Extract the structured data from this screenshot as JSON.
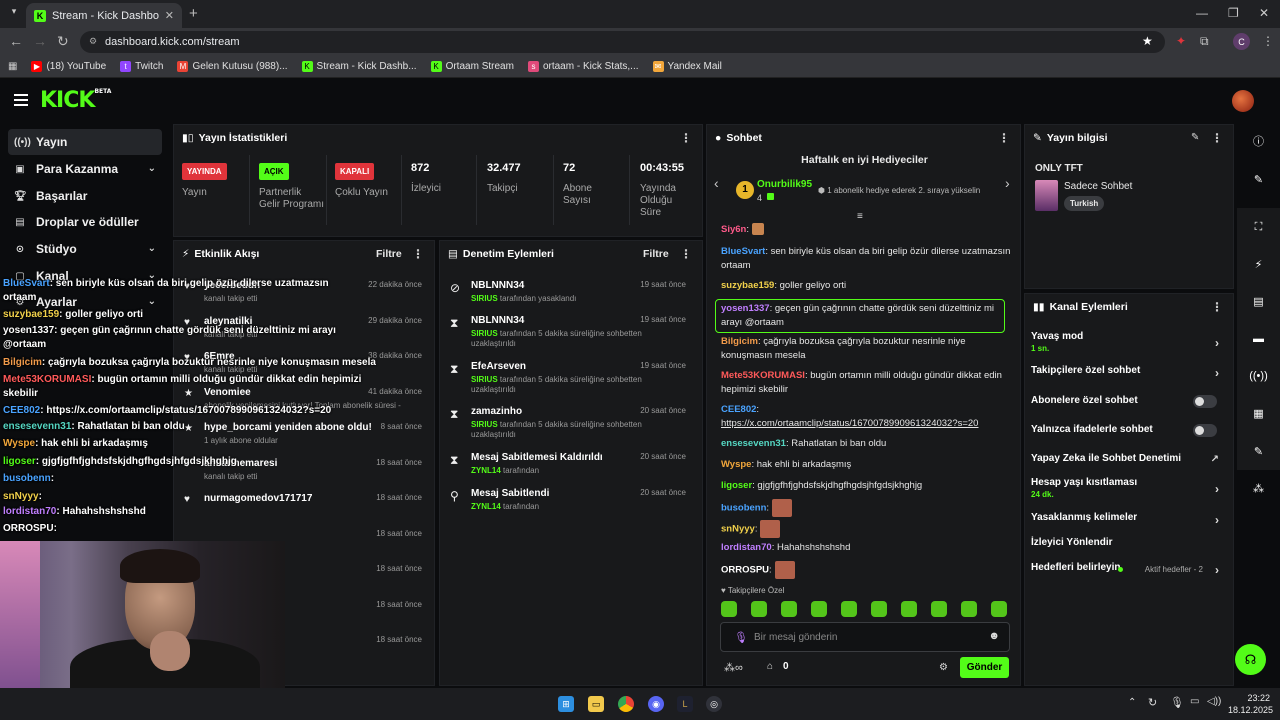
{
  "browser": {
    "tab_title": "Stream - Kick Dashboard",
    "url": "dashboard.kick.com/stream",
    "profile_initial": "C",
    "bookmarks": [
      {
        "label": "(18) YouTube",
        "color": "#ff0000",
        "icon": "youtube-icon"
      },
      {
        "label": "Twitch",
        "color": "#9146ff",
        "icon": "twitch-icon"
      },
      {
        "label": "Gelen Kutusu (988)...",
        "color": "#ea4335",
        "icon": "gmail-icon"
      },
      {
        "label": "Stream - Kick Dashb...",
        "color": "#53fc18",
        "icon": "kick-icon"
      },
      {
        "label": "Ortaam Stream",
        "color": "#53fc18",
        "icon": "kick-icon"
      },
      {
        "label": "ortaam - Kick Stats,...",
        "color": "#e04a7a",
        "icon": "stats-icon"
      },
      {
        "label": "Yandex Mail",
        "color": "#f2a73b",
        "icon": "mail-icon"
      }
    ]
  },
  "kick": {
    "logo": "KICK",
    "logo_sup": "BETA"
  },
  "sidebar": {
    "items": [
      {
        "label": "Yayın",
        "icon": "broadcast-icon"
      },
      {
        "label": "Para Kazanma",
        "icon": "money-icon"
      },
      {
        "label": "Başarılar",
        "icon": "trophy-icon"
      },
      {
        "label": "Droplar ve ödüller",
        "icon": "gift-icon"
      },
      {
        "label": "Stüdyo",
        "icon": "studio-icon"
      },
      {
        "label": "Kanal",
        "icon": "channel-icon"
      },
      {
        "label": "Ayarlar",
        "icon": "settings-icon"
      }
    ]
  },
  "overlay_chat": [
    {
      "user": "BlueSvart",
      "color": "#4aa3ff",
      "text": ": sen biriyle küs olsan da biri gelip özür dilerse uzatmazsın"
    },
    {
      "user": "",
      "color": "#fff",
      "text": "ortaam"
    },
    {
      "user": "suzybae159",
      "color": "#f2d14b",
      "text": ": goller geliyo orti"
    },
    {
      "user": "yosen1337",
      "color": "#ffffff",
      "text": ": geçen gün çağrının chatte gördük seni düzelttiniz mi arayı"
    },
    {
      "user": "",
      "color": "#fff",
      "text": "@ortaam"
    },
    {
      "user": "Bilgicim",
      "color": "#f29b4b",
      "text": ": çağrıyla bozuksa çağrıyla bozuktur nesrinle niye konuşmasın mesela"
    },
    {
      "user": "Mete53KORUMASI",
      "color": "#ff5a5a",
      "text": ": bugün ortamın milli olduğu gündür dikkat edin hepimizi"
    },
    {
      "user": "",
      "color": "#fff",
      "text": "skebilir"
    },
    {
      "user": "CEE802",
      "color": "#4aa3ff",
      "text": ": https://x.com/ortaamclip/status/1670078990961324032?s=20"
    },
    {
      "user": "ensesevenn31",
      "color": "#55d6c2",
      "text": ": Rahatlatan bi ban oldu"
    },
    {
      "user": "Wyspe",
      "color": "#f2a73b",
      "text": ": hak ehli bi arkadaşmış"
    },
    {
      "user": "ligoser",
      "color": "#53fc18",
      "text": ": gjgfjgfhfjghdsfskjdhgfhgdsjhfgdsjkhghjg"
    },
    {
      "user": "busobenn",
      "color": "#4aa3ff",
      "text": ":"
    },
    {
      "user": "snNyyy",
      "color": "#f2d14b",
      "text": ":"
    },
    {
      "user": "lordistan70",
      "color": "#c07fff",
      "text": ": Hahahshshshshd"
    },
    {
      "user": "ORROSPU",
      "color": "#ffffff",
      "text": ":"
    }
  ],
  "stats": {
    "title": "Yayın İstatistikleri",
    "items": [
      {
        "badge": "YAYINDA",
        "badge_color": "#e0343b",
        "label": "Yayın"
      },
      {
        "badge": "AÇIK",
        "badge_color": "#53fc18",
        "label": "Partnerlik Gelir Programı"
      },
      {
        "badge": "KAPALI",
        "badge_color": "#e0343b",
        "label": "Çoklu Yayın"
      },
      {
        "value": "872",
        "label": "İzleyici"
      },
      {
        "value": "32.477",
        "label": "Takipçi"
      },
      {
        "value": "72",
        "label": "Abone Sayısı"
      },
      {
        "value": "00:43:55",
        "label": "Yayında Olduğu Süre"
      }
    ]
  },
  "activity": {
    "title": "Etkinlik Akışı",
    "filter": "Filtre",
    "items": [
      {
        "name": "yecerbeddh",
        "sub": "kanalı takip etti",
        "time": "22 dakika önce",
        "icon": "heart-icon"
      },
      {
        "name": "aleynatilki",
        "sub": "kanalı takip etti",
        "time": "29 dakika önce",
        "icon": "heart-icon"
      },
      {
        "name": "6Emre",
        "sub": "kanalı takip etti",
        "time": "38 dakika önce",
        "icon": "heart-icon"
      },
      {
        "name": "Venomiee",
        "sub": "abonelik yenilemesini kutluyor! Toplam abonelik süresi -",
        "time": "41 dakika önce",
        "icon": "star-icon"
      },
      {
        "name": "hype_borcami yeniden abone oldu!",
        "sub": "1 aylık abone oldular",
        "time": "8 saat önce",
        "icon": "star-icon"
      },
      {
        "name": "anilarinemaresi",
        "sub": "kanalı takip etti",
        "time": "18 saat önce",
        "icon": "heart-icon"
      },
      {
        "name": "nurmagomedov171717",
        "sub": "",
        "time": "18 saat önce",
        "icon": "heart-icon"
      },
      {
        "name": "",
        "sub": "",
        "time": "18 saat önce",
        "icon": ""
      },
      {
        "name": "",
        "sub": "",
        "time": "18 saat önce",
        "icon": ""
      },
      {
        "name": "",
        "sub": "",
        "time": "18 saat önce",
        "icon": ""
      },
      {
        "name": "",
        "sub": "",
        "time": "18 saat önce",
        "icon": ""
      }
    ]
  },
  "moderation": {
    "title": "Denetim Eylemleri",
    "filter": "Filtre",
    "items": [
      {
        "name": "NBLNNN34",
        "by": "SIRIUS",
        "sub": "tarafından yasaklandı",
        "time": "19 saat önce",
        "icon": "ban-icon"
      },
      {
        "name": "NBLNNN34",
        "by": "SIRIUS",
        "sub": "tarafından 5 dakika süreliğine sohbetten uzaklaştırıldı",
        "time": "19 saat önce",
        "icon": "hourglass-icon"
      },
      {
        "name": "EfeArseven",
        "by": "SIRIUS",
        "sub": "tarafından 5 dakika süreliğine sohbetten uzaklaştırıldı",
        "time": "19 saat önce",
        "icon": "hourglass-icon"
      },
      {
        "name": "zamazinho",
        "by": "SIRIUS",
        "sub": "tarafından 5 dakika süreliğine sohbetten uzaklaştırıldı",
        "time": "20 saat önce",
        "icon": "hourglass-icon"
      },
      {
        "name": "Mesaj Sabitlemesi Kaldırıldı",
        "by": "ZYNL14",
        "sub": "tarafından",
        "time": "20 saat önce",
        "icon": "hourglass-icon"
      },
      {
        "name": "Mesaj Sabitlendi",
        "by": "ZYNL14",
        "sub": "tarafından",
        "time": "20 saat önce",
        "icon": "pin-icon"
      }
    ]
  },
  "chat": {
    "title": "Sohbet",
    "gifters_title": "Haftalık en iyi Hediyeciler",
    "top_gifter": "Onurbilik95",
    "top_gifter_rank": "1",
    "top_gifter_count": "4",
    "gift_hint": "1 abonelik hediye ederek 2. sıraya yükselin",
    "messages": [
      {
        "user": "Siy6n",
        "color": "#ff5a8a",
        "text": ":"
      },
      {
        "user": "BlueSvart",
        "color": "#4aa3ff",
        "text": ": sen biriyle küs olsan da biri gelip özür dilerse uzatmazsın ortaam"
      },
      {
        "user": "suzybae159",
        "color": "#f2d14b",
        "text": ": goller geliyo orti"
      },
      {
        "user": "yosen1337",
        "color": "#c07fff",
        "text": ": geçen gün çağrının chatte gördük seni düzelttiniz mi arayı @ortaam"
      },
      {
        "user": "Bilgicim",
        "color": "#f29b4b",
        "text": ": çağrıyla bozuksa çağrıyla bozuktur nesrinle niye konuşmasın mesela"
      },
      {
        "user": "Mete53KORUMASI",
        "color": "#ff5a5a",
        "text": ": bugün ortamın milli olduğu gündür dikkat edin hepimizi skebilir"
      },
      {
        "user": "CEE802",
        "color": "#4aa3ff",
        "text": ":"
      },
      {
        "user": "",
        "color": "#fff",
        "text": "https://x.com/ortaamclip/status/1670078990961324032?s=20"
      },
      {
        "user": "ensesevenn31",
        "color": "#55d6c2",
        "text": ": Rahatlatan bi ban oldu"
      },
      {
        "user": "Wyspe",
        "color": "#f2a73b",
        "text": ": hak ehli bi arkadaşmış"
      },
      {
        "user": "ligoser",
        "color": "#53fc18",
        "text": ": gjgfjgfhfjghdsfskjdhgfhgdsjhfgdsjkhghjg"
      },
      {
        "user": "busobenn",
        "color": "#4aa3ff",
        "text": ":"
      },
      {
        "user": "snNyyy",
        "color": "#f2d14b",
        "text": ":"
      },
      {
        "user": "lordistan70",
        "color": "#c07fff",
        "text": ": Hahahshshshshd"
      },
      {
        "user": "ORROSPU",
        "color": "#ffffff",
        "text": ":"
      }
    ],
    "emote_label": "Takipçilere Özel",
    "input_placeholder": "Bir mesaj gönderin",
    "points": "0",
    "send": "Gönder"
  },
  "stream_info": {
    "title": "Yayın bilgisi",
    "stream_title": "ONLY TFT",
    "category": "Sadece Sohbet",
    "tag": "Turkish"
  },
  "channel_actions": {
    "title": "Kanal Eylemleri",
    "items": [
      {
        "label": "Yavaş mod",
        "sub": "1 sn.",
        "control": "arrow"
      },
      {
        "label": "Takipçilere özel sohbet",
        "sub": "",
        "control": "arrow"
      },
      {
        "label": "Abonelere özel sohbet",
        "sub": "",
        "control": "toggle"
      },
      {
        "label": "Yalnızca ifadelerle sohbet",
        "sub": "",
        "control": "toggle"
      },
      {
        "label": "Yapay Zeka ile Sohbet Denetimi",
        "sub": "",
        "control": "external"
      },
      {
        "label": "Hesap yaşı kısıtlaması",
        "sub": "24 dk.",
        "control": "arrow"
      },
      {
        "label": "Yasaklanmış kelimeler",
        "sub": "",
        "control": "arrow"
      },
      {
        "label": "İzleyici Yönlendir",
        "sub": "",
        "control": "none"
      },
      {
        "label": "Hedefleri belirleyin",
        "sub": "",
        "control": "arrow",
        "extra": "Aktif hedefler - 2"
      }
    ]
  },
  "taskbar": {
    "time": "23:22",
    "date": "18.12.2025"
  },
  "colors": {
    "accent": "#53fc18",
    "live": "#e0343b",
    "panel": "#18191b"
  }
}
